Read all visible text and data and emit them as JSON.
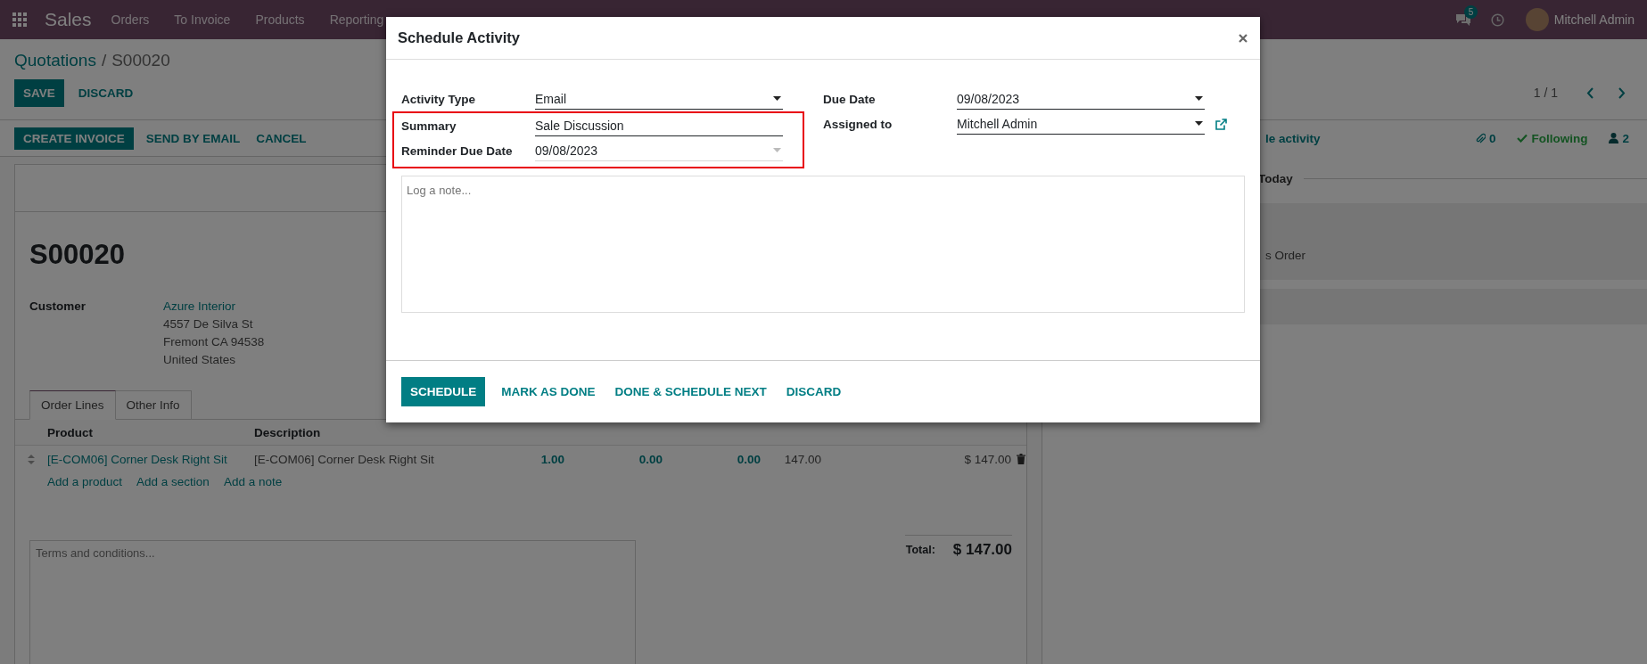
{
  "navbar": {
    "app": "Sales",
    "menu": [
      "Orders",
      "To Invoice",
      "Products",
      "Reporting"
    ],
    "messages_badge": "5",
    "user": "Mitchell Admin"
  },
  "breadcrumb": {
    "parent": "Quotations",
    "separator": "/",
    "current": "S00020"
  },
  "edit_buttons": [
    {
      "label": "SAVE",
      "kind": "primary"
    },
    {
      "label": "DISCARD",
      "kind": "link"
    }
  ],
  "pager": "1 / 1",
  "status_buttons": [
    {
      "label": "CREATE INVOICE",
      "kind": "primary"
    },
    {
      "label": "SEND BY EMAIL",
      "kind": "link"
    },
    {
      "label": "CANCEL",
      "kind": "link"
    }
  ],
  "form": {
    "title": "S00020",
    "customer_label": "Customer",
    "customer": "Azure Interior",
    "address": [
      "4557 De Silva St",
      "Fremont CA 94538",
      "United States"
    ],
    "tabs": [
      {
        "label": "Order Lines",
        "selected": true
      },
      {
        "label": "Other Info",
        "selected": false
      }
    ],
    "columns": [
      "Product",
      "Description"
    ],
    "lines": [
      {
        "product": "[E-COM06] Corner Desk Right Sit",
        "description": "[E-COM06] Corner Desk Right Sit",
        "column_3": "1.00",
        "column_4": "0.00",
        "column_5": "0.00",
        "column_6": "147.00",
        "column_7": "$ 147.00"
      }
    ],
    "add_links": [
      "Add a product",
      "Add a section",
      "Add a note"
    ],
    "terms_placeholder": "Terms and conditions...",
    "total_label": "Total:",
    "total": "$ 147.00"
  },
  "chatter": {
    "schedule": "le activity",
    "attachments": "0",
    "following": "Following",
    "followers": "2",
    "separator": "Today",
    "message": "s Order"
  },
  "dialog": {
    "title": "Schedule Activity",
    "left_fields": [
      {
        "label": "Activity Type",
        "value": "Email",
        "kind": "select",
        "readonly": false,
        "highlighted": false
      },
      {
        "label": "Summary",
        "value": "Sale Discussion",
        "kind": "text",
        "readonly": false,
        "highlighted": true
      },
      {
        "label": "Reminder Due Date",
        "value": "09/08/2023",
        "kind": "select",
        "readonly": true,
        "highlighted": true
      }
    ],
    "right_fields": [
      {
        "label": "Due Date",
        "value": "09/08/2023",
        "kind": "select",
        "readonly": false,
        "highlighted": false
      },
      {
        "label": "Assigned to",
        "value": "Mitchell Admin",
        "kind": "select",
        "readonly": false,
        "highlighted": false,
        "link_button": true
      }
    ],
    "note_placeholder": "Log a note...",
    "buttons": [
      {
        "label": "SCHEDULE",
        "kind": "primary"
      },
      {
        "label": "MARK AS DONE",
        "kind": "link"
      },
      {
        "label": "DONE & SCHEDULE NEXT",
        "kind": "link"
      },
      {
        "label": "DISCARD",
        "kind": "link"
      }
    ]
  }
}
